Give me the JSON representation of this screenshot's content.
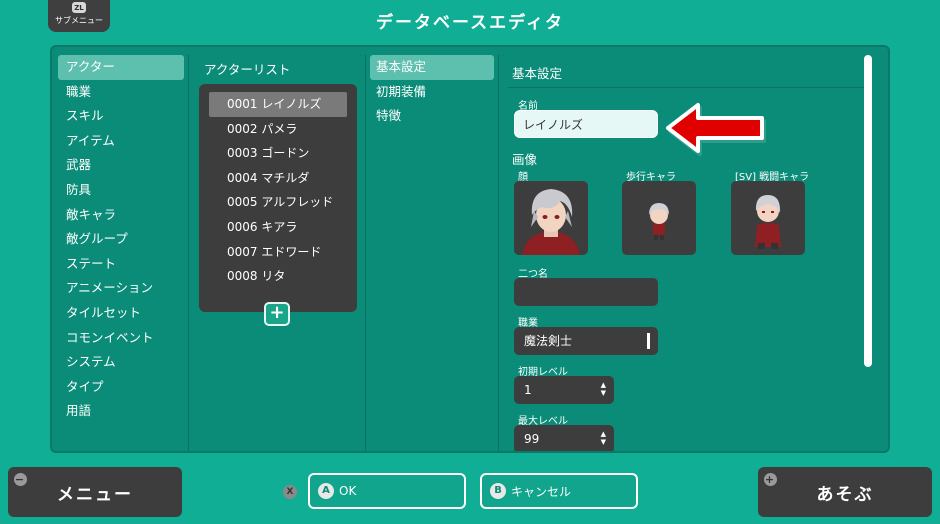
{
  "header": {
    "title": "データベースエディタ",
    "submenu_key": "ZL",
    "submenu_label": "サブメニュー"
  },
  "categories": [
    "アクター",
    "職業",
    "スキル",
    "アイテム",
    "武器",
    "防具",
    "敵キャラ",
    "敵グループ",
    "ステート",
    "アニメーション",
    "タイルセット",
    "コモンイベント",
    "システム",
    "タイプ",
    "用語"
  ],
  "actor_list": {
    "header": "アクターリスト",
    "items": [
      "0001 レイノルズ",
      "0002 パメラ",
      "0003 ゴードン",
      "0004 マチルダ",
      "0005 アルフレッド",
      "0006 キアラ",
      "0007 エドワード",
      "0008 リタ"
    ],
    "add_symbol": "+"
  },
  "tabs": [
    "基本設定",
    "初期装備",
    "特徴"
  ],
  "detail": {
    "title": "基本設定",
    "name_label": "名前",
    "name_value": "レイノルズ",
    "image_section": "画像",
    "face_label": "顔",
    "walk_label": "歩行キャラ",
    "battler_label": "[SV] 戦闘キャラ",
    "nickname_label": "二つ名",
    "nickname_value": "",
    "class_label": "職業",
    "class_value": "魔法剣士",
    "initial_level_label": "初期レベル",
    "initial_level_value": "1",
    "max_level_label": "最大レベル",
    "max_level_value": "99"
  },
  "footer": {
    "menu_key": "−",
    "menu_label": "メニュー",
    "x_key": "X",
    "ok_key": "A",
    "ok_label": "OK",
    "cancel_key": "B",
    "cancel_label": "キャンセル",
    "play_key": "+",
    "play_label": "あそぶ"
  },
  "colors": {
    "background": "#0fae95",
    "panel": "#0a8c78",
    "dark": "#3d3d3d",
    "selected": "#5dbfad",
    "arrow": "#e00000"
  }
}
